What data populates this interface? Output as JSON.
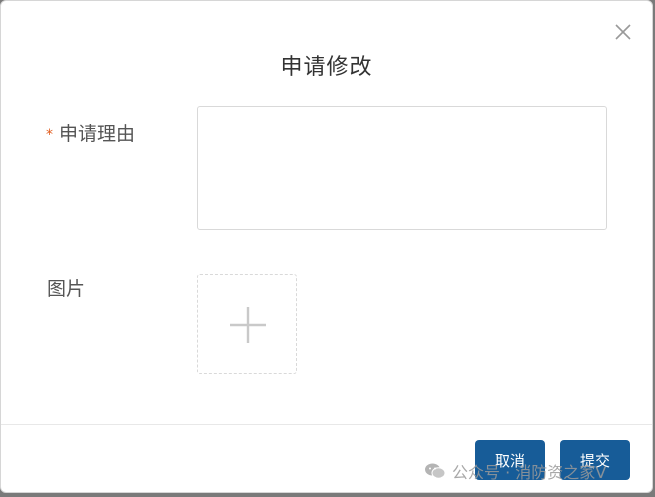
{
  "dialog": {
    "title": "申请修改",
    "close_icon": "close-icon"
  },
  "form": {
    "reason": {
      "required_mark": "*",
      "label": "申请理由",
      "value": ""
    },
    "image": {
      "label": "图片",
      "upload_icon": "plus-icon"
    }
  },
  "footer": {
    "cancel_label": "取消",
    "submit_label": "提交"
  },
  "watermark": {
    "text": "公众号 · 消防资之家V",
    "icon": "wechat-icon"
  },
  "colors": {
    "primary_button": "#175c98",
    "required_mark": "#e05a1b"
  }
}
